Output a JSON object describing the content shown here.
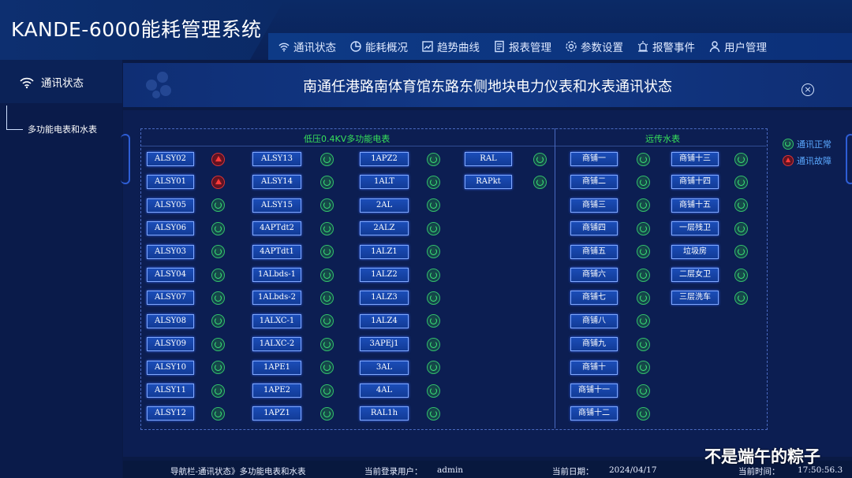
{
  "app": {
    "title": "KANDE-6000能耗管理系统"
  },
  "nav": {
    "items": [
      {
        "label": "通讯状态",
        "icon": "wifi-icon"
      },
      {
        "label": "能耗概况",
        "icon": "pie-chart-icon"
      },
      {
        "label": "趋势曲线",
        "icon": "trend-chart-icon"
      },
      {
        "label": "报表管理",
        "icon": "report-icon"
      },
      {
        "label": "参数设置",
        "icon": "gear-icon"
      },
      {
        "label": "报警事件",
        "icon": "alarm-icon"
      },
      {
        "label": "用户管理",
        "icon": "user-icon"
      }
    ]
  },
  "sidebar": {
    "header": "通讯状态",
    "items": [
      {
        "label": "多功能电表和水表"
      }
    ]
  },
  "main": {
    "title": "南通任港路南体育馆东路东侧地块电力仪表和水表通讯状态",
    "close_label": "×"
  },
  "sections": {
    "electric_title": "低压0.4KV多功能电表",
    "water_title": "远传水表"
  },
  "legend": {
    "ok_label": "通讯正常",
    "err_label": "通讯故障"
  },
  "electric_meters": [
    [
      {
        "name": "ALSY02",
        "status": "fault"
      },
      {
        "name": "ALSY01",
        "status": "fault"
      },
      {
        "name": "ALSY05",
        "status": "ok"
      },
      {
        "name": "ALSY06",
        "status": "ok"
      },
      {
        "name": "ALSY03",
        "status": "ok"
      },
      {
        "name": "ALSY04",
        "status": "ok"
      },
      {
        "name": "ALSY07",
        "status": "ok"
      },
      {
        "name": "ALSY08",
        "status": "ok"
      },
      {
        "name": "ALSY09",
        "status": "ok"
      },
      {
        "name": "ALSY10",
        "status": "ok"
      },
      {
        "name": "ALSY11",
        "status": "ok"
      },
      {
        "name": "ALSY12",
        "status": "ok"
      }
    ],
    [
      {
        "name": "ALSY13",
        "status": "ok"
      },
      {
        "name": "ALSY14",
        "status": "ok"
      },
      {
        "name": "ALSY15",
        "status": "ok"
      },
      {
        "name": "4APTdt2",
        "status": "ok"
      },
      {
        "name": "4APTdt1",
        "status": "ok"
      },
      {
        "name": "1ALbds-1",
        "status": "ok"
      },
      {
        "name": "1ALbds-2",
        "status": "ok"
      },
      {
        "name": "1ALXC-1",
        "status": "ok"
      },
      {
        "name": "1ALXC-2",
        "status": "ok"
      },
      {
        "name": "1APE1",
        "status": "ok"
      },
      {
        "name": "1APE2",
        "status": "ok"
      },
      {
        "name": "1APZ1",
        "status": "ok"
      }
    ],
    [
      {
        "name": "1APZ2",
        "status": "ok"
      },
      {
        "name": "1ALT",
        "status": "ok"
      },
      {
        "name": "2AL",
        "status": "ok"
      },
      {
        "name": "2ALZ",
        "status": "ok"
      },
      {
        "name": "1ALZ1",
        "status": "ok"
      },
      {
        "name": "1ALZ2",
        "status": "ok"
      },
      {
        "name": "1ALZ3",
        "status": "ok"
      },
      {
        "name": "1ALZ4",
        "status": "ok"
      },
      {
        "name": "3APEj1",
        "status": "ok"
      },
      {
        "name": "3AL",
        "status": "ok"
      },
      {
        "name": "4AL",
        "status": "ok"
      },
      {
        "name": "RAL1h",
        "status": "ok"
      }
    ],
    [
      {
        "name": "RAL",
        "status": "ok"
      },
      {
        "name": "RAPkt",
        "status": "ok"
      }
    ]
  ],
  "water_meters": [
    [
      {
        "name": "商铺一",
        "status": "ok"
      },
      {
        "name": "商铺二",
        "status": "ok"
      },
      {
        "name": "商铺三",
        "status": "ok"
      },
      {
        "name": "商铺四",
        "status": "ok"
      },
      {
        "name": "商铺五",
        "status": "ok"
      },
      {
        "name": "商铺六",
        "status": "ok"
      },
      {
        "name": "商铺七",
        "status": "ok"
      },
      {
        "name": "商铺八",
        "status": "ok"
      },
      {
        "name": "商铺九",
        "status": "ok"
      },
      {
        "name": "商铺十",
        "status": "ok"
      },
      {
        "name": "商铺十一",
        "status": "ok"
      },
      {
        "name": "商铺十二",
        "status": "ok"
      }
    ],
    [
      {
        "name": "商铺十三",
        "status": "ok"
      },
      {
        "name": "商铺十四",
        "status": "ok"
      },
      {
        "name": "商铺十五",
        "status": "ok"
      },
      {
        "name": "一层残卫",
        "status": "ok"
      },
      {
        "name": "垃圾房",
        "status": "ok"
      },
      {
        "name": "二层女卫",
        "status": "ok"
      },
      {
        "name": "三层洗车",
        "status": "ok"
      }
    ]
  ],
  "footer": {
    "breadcrumb": "导航栏-通讯状态》多功能电表和水表",
    "user_label": "当前登录用户：",
    "user": "admin",
    "date_label": "当前日期：",
    "date": "2024/04/17",
    "time_label": "当前时间：",
    "time": "17:50:56.3"
  },
  "watermark": "不是端午的粽子",
  "colors": {
    "accent": "#37e25a",
    "fault": "#ff3a3a",
    "background": "#0a1a45"
  }
}
